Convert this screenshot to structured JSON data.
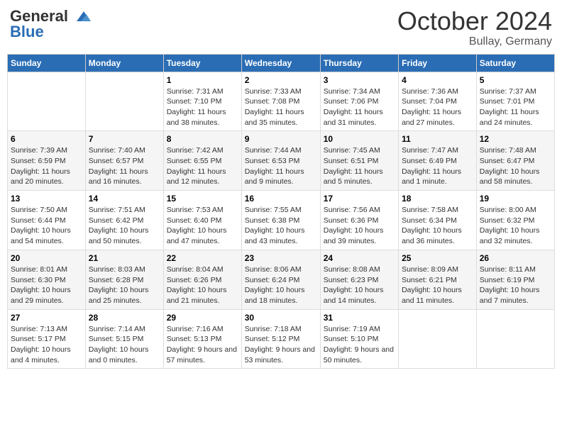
{
  "header": {
    "logo_line1": "General",
    "logo_line2": "Blue",
    "month": "October 2024",
    "location": "Bullay, Germany"
  },
  "weekdays": [
    "Sunday",
    "Monday",
    "Tuesday",
    "Wednesday",
    "Thursday",
    "Friday",
    "Saturday"
  ],
  "weeks": [
    [
      {
        "day": "",
        "info": ""
      },
      {
        "day": "",
        "info": ""
      },
      {
        "day": "1",
        "info": "Sunrise: 7:31 AM\nSunset: 7:10 PM\nDaylight: 11 hours and 38 minutes."
      },
      {
        "day": "2",
        "info": "Sunrise: 7:33 AM\nSunset: 7:08 PM\nDaylight: 11 hours and 35 minutes."
      },
      {
        "day": "3",
        "info": "Sunrise: 7:34 AM\nSunset: 7:06 PM\nDaylight: 11 hours and 31 minutes."
      },
      {
        "day": "4",
        "info": "Sunrise: 7:36 AM\nSunset: 7:04 PM\nDaylight: 11 hours and 27 minutes."
      },
      {
        "day": "5",
        "info": "Sunrise: 7:37 AM\nSunset: 7:01 PM\nDaylight: 11 hours and 24 minutes."
      }
    ],
    [
      {
        "day": "6",
        "info": "Sunrise: 7:39 AM\nSunset: 6:59 PM\nDaylight: 11 hours and 20 minutes."
      },
      {
        "day": "7",
        "info": "Sunrise: 7:40 AM\nSunset: 6:57 PM\nDaylight: 11 hours and 16 minutes."
      },
      {
        "day": "8",
        "info": "Sunrise: 7:42 AM\nSunset: 6:55 PM\nDaylight: 11 hours and 12 minutes."
      },
      {
        "day": "9",
        "info": "Sunrise: 7:44 AM\nSunset: 6:53 PM\nDaylight: 11 hours and 9 minutes."
      },
      {
        "day": "10",
        "info": "Sunrise: 7:45 AM\nSunset: 6:51 PM\nDaylight: 11 hours and 5 minutes."
      },
      {
        "day": "11",
        "info": "Sunrise: 7:47 AM\nSunset: 6:49 PM\nDaylight: 11 hours and 1 minute."
      },
      {
        "day": "12",
        "info": "Sunrise: 7:48 AM\nSunset: 6:47 PM\nDaylight: 10 hours and 58 minutes."
      }
    ],
    [
      {
        "day": "13",
        "info": "Sunrise: 7:50 AM\nSunset: 6:44 PM\nDaylight: 10 hours and 54 minutes."
      },
      {
        "day": "14",
        "info": "Sunrise: 7:51 AM\nSunset: 6:42 PM\nDaylight: 10 hours and 50 minutes."
      },
      {
        "day": "15",
        "info": "Sunrise: 7:53 AM\nSunset: 6:40 PM\nDaylight: 10 hours and 47 minutes."
      },
      {
        "day": "16",
        "info": "Sunrise: 7:55 AM\nSunset: 6:38 PM\nDaylight: 10 hours and 43 minutes."
      },
      {
        "day": "17",
        "info": "Sunrise: 7:56 AM\nSunset: 6:36 PM\nDaylight: 10 hours and 39 minutes."
      },
      {
        "day": "18",
        "info": "Sunrise: 7:58 AM\nSunset: 6:34 PM\nDaylight: 10 hours and 36 minutes."
      },
      {
        "day": "19",
        "info": "Sunrise: 8:00 AM\nSunset: 6:32 PM\nDaylight: 10 hours and 32 minutes."
      }
    ],
    [
      {
        "day": "20",
        "info": "Sunrise: 8:01 AM\nSunset: 6:30 PM\nDaylight: 10 hours and 29 minutes."
      },
      {
        "day": "21",
        "info": "Sunrise: 8:03 AM\nSunset: 6:28 PM\nDaylight: 10 hours and 25 minutes."
      },
      {
        "day": "22",
        "info": "Sunrise: 8:04 AM\nSunset: 6:26 PM\nDaylight: 10 hours and 21 minutes."
      },
      {
        "day": "23",
        "info": "Sunrise: 8:06 AM\nSunset: 6:24 PM\nDaylight: 10 hours and 18 minutes."
      },
      {
        "day": "24",
        "info": "Sunrise: 8:08 AM\nSunset: 6:23 PM\nDaylight: 10 hours and 14 minutes."
      },
      {
        "day": "25",
        "info": "Sunrise: 8:09 AM\nSunset: 6:21 PM\nDaylight: 10 hours and 11 minutes."
      },
      {
        "day": "26",
        "info": "Sunrise: 8:11 AM\nSunset: 6:19 PM\nDaylight: 10 hours and 7 minutes."
      }
    ],
    [
      {
        "day": "27",
        "info": "Sunrise: 7:13 AM\nSunset: 5:17 PM\nDaylight: 10 hours and 4 minutes."
      },
      {
        "day": "28",
        "info": "Sunrise: 7:14 AM\nSunset: 5:15 PM\nDaylight: 10 hours and 0 minutes."
      },
      {
        "day": "29",
        "info": "Sunrise: 7:16 AM\nSunset: 5:13 PM\nDaylight: 9 hours and 57 minutes."
      },
      {
        "day": "30",
        "info": "Sunrise: 7:18 AM\nSunset: 5:12 PM\nDaylight: 9 hours and 53 minutes."
      },
      {
        "day": "31",
        "info": "Sunrise: 7:19 AM\nSunset: 5:10 PM\nDaylight: 9 hours and 50 minutes."
      },
      {
        "day": "",
        "info": ""
      },
      {
        "day": "",
        "info": ""
      }
    ]
  ]
}
